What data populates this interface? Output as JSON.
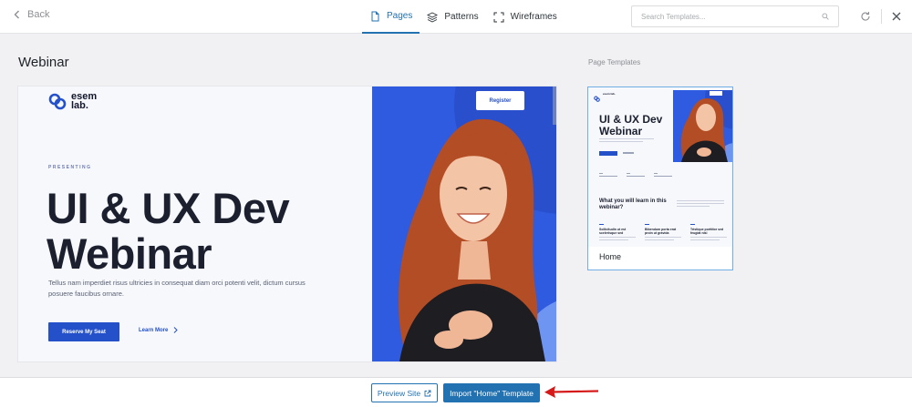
{
  "topbar": {
    "back_label": "Back",
    "tabs": [
      {
        "label": "Pages",
        "icon": "page-icon",
        "active": true
      },
      {
        "label": "Patterns",
        "icon": "layers-icon",
        "active": false
      },
      {
        "label": "Wireframes",
        "icon": "wireframe-icon",
        "active": false
      }
    ],
    "search_placeholder": "Search Templates..."
  },
  "main": {
    "title": "Webinar"
  },
  "preview": {
    "logo_text": "esem lab.",
    "register_label": "Register",
    "eyebrow": "PRESENTING",
    "headline": "UI & UX Dev Webinar",
    "body": "Tellus nam imperdiet risus ultricies in consequat diam orci potenti velit, dictum cursus posuere faucibus ornare.",
    "reserve_label": "Reserve My Seat",
    "learn_more_label": "Learn More"
  },
  "sidebar": {
    "label": "Page Templates",
    "templates": [
      {
        "name": "Home",
        "headline": "UI & UX Dev Webinar",
        "subheading": "What you will learn in this webinar?",
        "columns": [
          "Sollicitudin ut est scelerisque sed",
          "Bibendum porta erat proin ut gravida",
          "Tristique porttitor sed feugiat nisl"
        ]
      }
    ]
  },
  "footer": {
    "preview_label": "Preview Site",
    "import_label": "Import \"Home\" Template"
  },
  "colors": {
    "accent": "#2271b1",
    "hero_blue": "#2f5be0",
    "annotation_arrow": "#d61a1a"
  }
}
